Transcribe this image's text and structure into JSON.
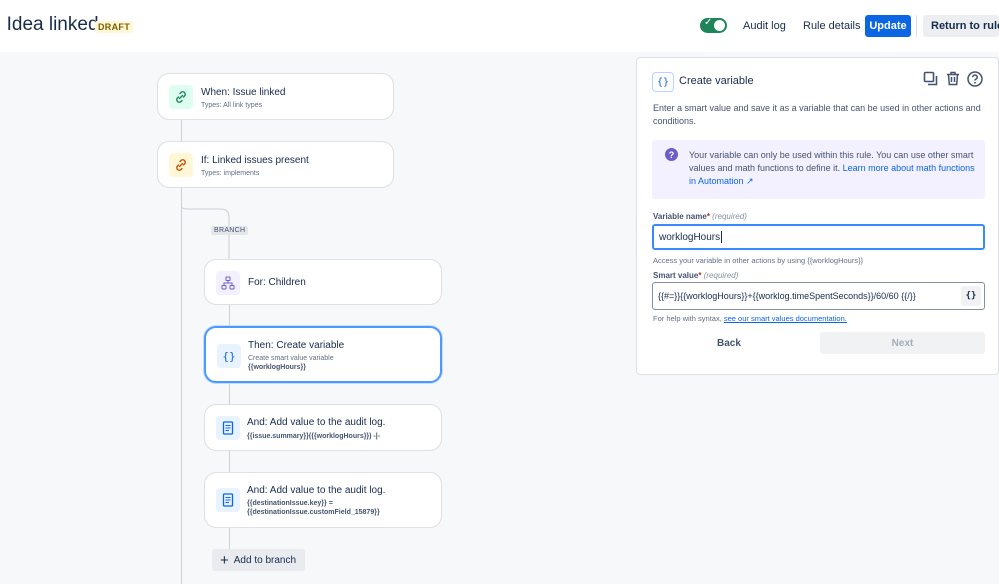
{
  "header": {
    "title": "Idea linked",
    "draft_badge": "DRAFT",
    "links": [
      "Audit log",
      "Rule details"
    ],
    "update_label": "Update",
    "return_label": "Return to rules",
    "toggle_on": true,
    "colors": {
      "primary": "#0c66e4",
      "toggle": "#1f845a"
    }
  },
  "flow": {
    "trigger": {
      "title": "When: Issue linked",
      "subtitle": "Types: All link types"
    },
    "condition": {
      "title": "If: Linked issues present",
      "subtitle": "Types: implements"
    },
    "branch_label": "BRANCH",
    "branch_step": {
      "title": "For: Children"
    },
    "steps": [
      {
        "title": "Then: Create variable",
        "subtitle": "Create smart value variable",
        "code": "{{worklogHours}}",
        "icon": "curly-braces-icon"
      },
      {
        "title": "And: Add value to the audit log.",
        "code": "{{issue.summary}}({{worklogHours}}) -|-",
        "icon": "document-icon"
      },
      {
        "title": "And: Add value to the audit log.",
        "code": "{{destinationIssue.key}} =",
        "code2": "{{destinationIssue.customField_15879}}",
        "icon": "document-icon"
      }
    ],
    "add_branch_label": "Add to branch"
  },
  "panel": {
    "title": "Create variable",
    "description": "Enter a smart value and save it as a variable that can be used in other actions and conditions.",
    "info_text": "Your variable can only be used within this rule. You can use other smart values and math functions to define it.",
    "info_link": "Learn more about math functions in Automation ↗",
    "variable_name": {
      "label": "Variable name",
      "required_marker": "*",
      "hint": "(required)",
      "value": "worklogHours",
      "help": "Access your variable in other actions by using {{worklogHours}}"
    },
    "smart_value": {
      "label": "Smart value",
      "required_marker": "*",
      "hint": "(required)",
      "value": "{{#=}}{{worklogHours}}+{{worklog.timeSpentSeconds}}/60/60 {{/}}",
      "button_label": "{}",
      "help_prefix": "For help with syntax,",
      "help_link": "see our smart values documentation."
    },
    "back_label": "Back",
    "next_label": "Next"
  }
}
